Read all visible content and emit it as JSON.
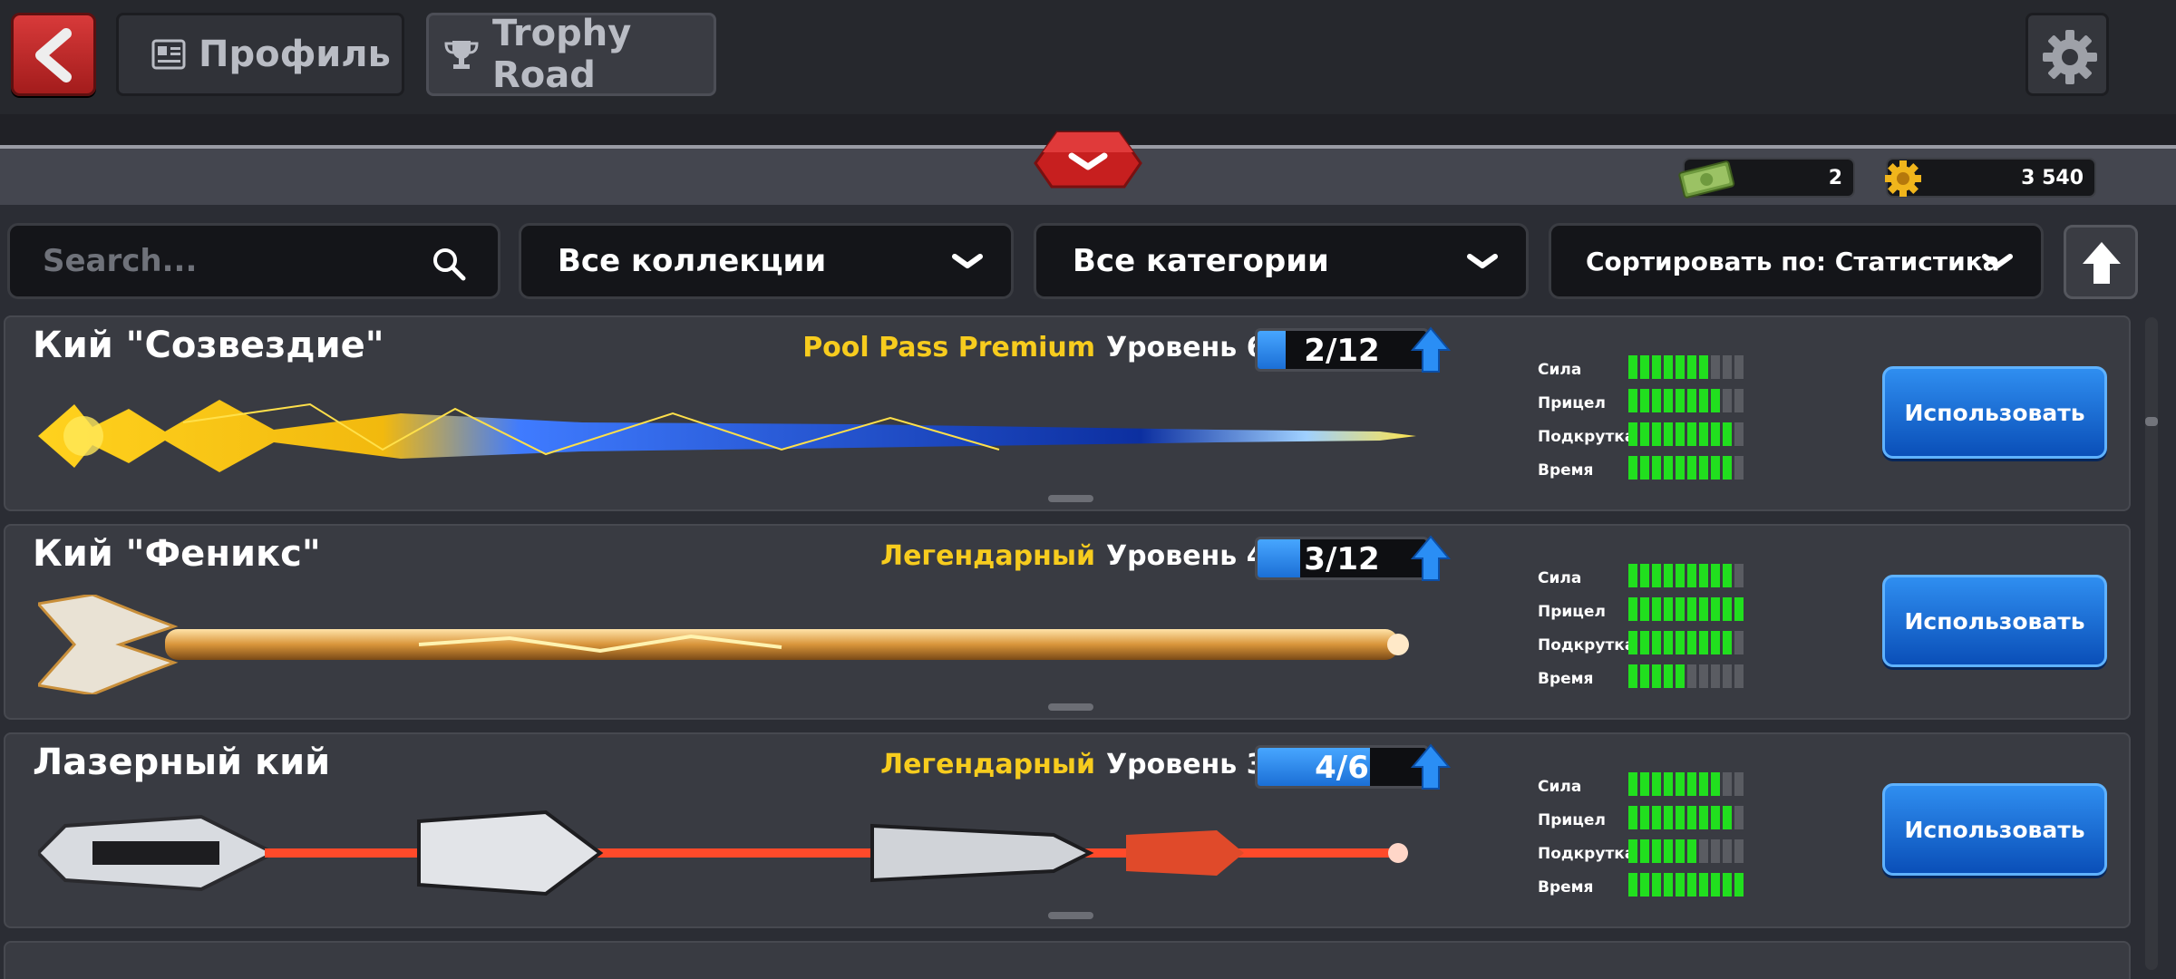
{
  "header": {
    "tabs": [
      {
        "label": "Профиль",
        "icon": "profile-card-icon"
      },
      {
        "label": "Trophy Road",
        "icon": "trophy-icon"
      }
    ]
  },
  "currency": {
    "cash": "2",
    "coins": "3 540"
  },
  "filters": {
    "search_placeholder": "Search...",
    "collections": "Все коллекции",
    "categories": "Все категории",
    "sort": "Сортировать по: Статистика"
  },
  "stat_labels": [
    "Сила",
    "Прицел",
    "Подкрутка",
    "Время"
  ],
  "cues": [
    {
      "name": "Кий \"Созвездие\"",
      "rarity": "Pool Pass Premium",
      "level": "Уровень 6",
      "progress_text": "2/12",
      "progress_fraction": 0.167,
      "stats": [
        7,
        8,
        9,
        9
      ],
      "action": "Использовать"
    },
    {
      "name": "Кий \"Феникс\"",
      "rarity": "Легендарный",
      "level": "Уровень 4",
      "progress_text": "3/12",
      "progress_fraction": 0.25,
      "stats": [
        9,
        10,
        9,
        5
      ],
      "action": "Использовать"
    },
    {
      "name": "Лазерный кий",
      "rarity": "Легендарный",
      "level": "Уровень 3",
      "progress_text": "4/6",
      "progress_fraction": 0.667,
      "stats": [
        8,
        9,
        6,
        10
      ],
      "action": "Использовать"
    }
  ],
  "stat_max": 10,
  "colors": {
    "rarity": "#f7cc1e",
    "stat_on": "#21df1e",
    "use_button": "#1a6fdc",
    "back_button": "#c92a2a"
  }
}
